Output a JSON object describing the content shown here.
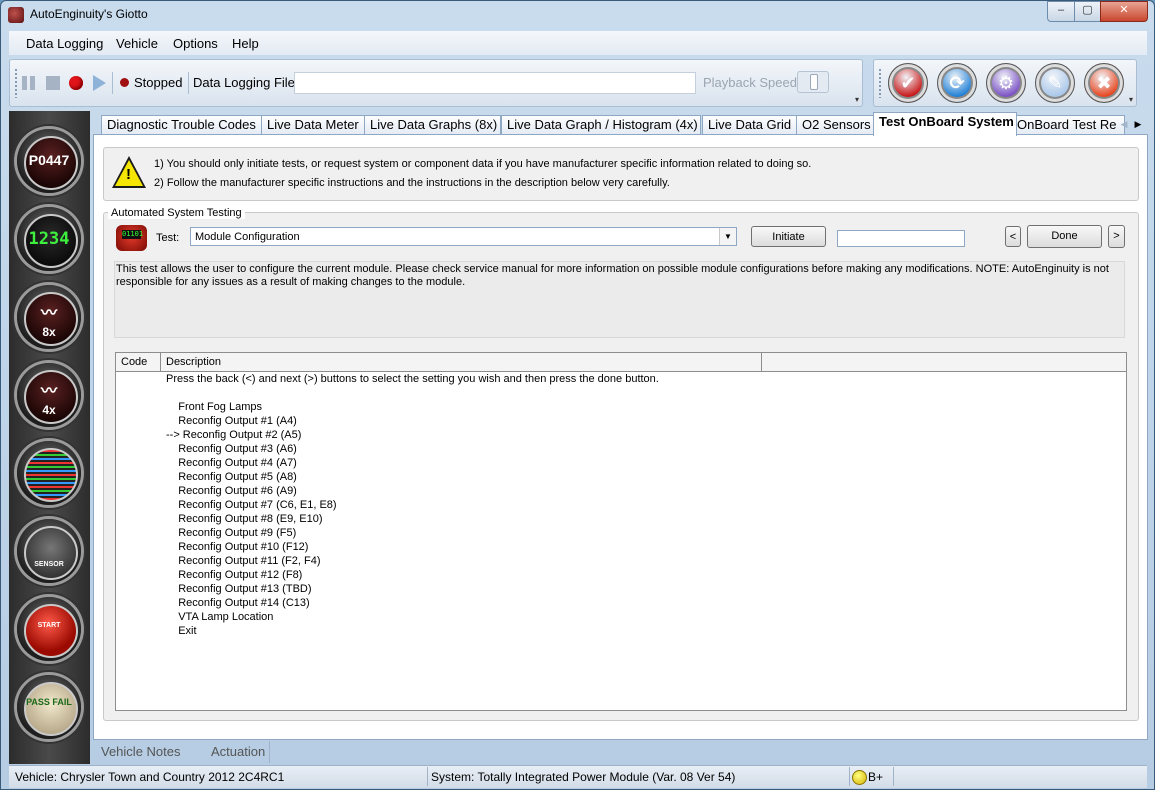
{
  "window": {
    "title": "AutoEnginuity's Giotto",
    "controls": {
      "minimize": "‒",
      "maximize": "▢",
      "close": "✕"
    }
  },
  "menu": {
    "items": [
      "Data Logging",
      "Vehicle",
      "Options",
      "Help"
    ]
  },
  "logging_toolbar": {
    "status": "Stopped",
    "file_label": "Data Logging File",
    "file_value": "",
    "playback_label": "Playback Speed"
  },
  "action_toolbar": {
    "buttons": [
      {
        "icon": "clipboard-check-icon",
        "color": "#c81414"
      },
      {
        "icon": "refresh-icon",
        "color": "#1e7fd6"
      },
      {
        "icon": "engine-rpm-icon",
        "color": "#7a4fc4"
      },
      {
        "icon": "wrench-icon",
        "color": "#a9c7ea"
      },
      {
        "icon": "no-connect-icon",
        "color": "#e8441c"
      }
    ]
  },
  "sidebar": {
    "buttons": [
      {
        "icon": "dtc-icon",
        "text": "P0447"
      },
      {
        "icon": "meter-icon",
        "text": "1234"
      },
      {
        "icon": "graph-8x-icon",
        "text": "8x"
      },
      {
        "icon": "graph-4x-icon",
        "text": "4x"
      },
      {
        "icon": "data-grid-icon",
        "text": ""
      },
      {
        "icon": "o2-sensor-icon",
        "text": "SENSOR"
      },
      {
        "icon": "start-button-icon",
        "text": "START"
      },
      {
        "icon": "pass-fail-icon",
        "text": "PASS FAIL"
      }
    ]
  },
  "tabs": {
    "items": [
      "Diagnostic Trouble Codes",
      "Live Data Meter",
      "Live Data Graphs (8x)",
      "Live Data Graph / Histogram (4x)",
      "Live Data Grid",
      "O2 Sensors",
      "Test OnBoard System",
      "OnBoard Test Re"
    ],
    "active": "Test OnBoard System"
  },
  "warning": {
    "line1": "1) You should only initiate tests, or request system or component data if you have manufacturer specific information related to doing so.",
    "line2": "2) Follow the manufacturer specific instructions and the instructions in the description below very carefully."
  },
  "automated_testing": {
    "group_title": "Automated System Testing",
    "test_label": "Test:",
    "test_icon_text": "01101",
    "test_value": "Module Configuration",
    "initiate_label": "Initiate",
    "result_value": "",
    "prev_label": "<",
    "done_label": "Done",
    "next_label": ">",
    "description": "This test allows the user to configure the current module. Please check service manual for more information on possible module configurations before making any modifications. NOTE: AutoEnginuity is not responsible for any issues as a result of making changes to the module."
  },
  "results_grid": {
    "columns": [
      "Code",
      "Description",
      ""
    ],
    "rows": [
      "Press the back (<) and next (>) buttons to select the setting you wish and then press the done button.",
      "",
      "    Front Fog Lamps",
      "    Reconfig Output #1 (A4)",
      "--> Reconfig Output #2 (A5)",
      "    Reconfig Output #3 (A6)",
      "    Reconfig Output #4 (A7)",
      "    Reconfig Output #5 (A8)",
      "    Reconfig Output #6 (A9)",
      "    Reconfig Output #7 (C6, E1, E8)",
      "    Reconfig Output #8 (E9, E10)",
      "    Reconfig Output #9 (F5)",
      "    Reconfig Output #10 (F12)",
      "    Reconfig Output #11 (F2, F4)",
      "    Reconfig Output #12 (F8)",
      "    Reconfig Output #13 (TBD)",
      "    Reconfig Output #14 (C13)",
      "    VTA Lamp Location",
      "    Exit"
    ]
  },
  "bottom_tabs": [
    "Vehicle Notes",
    "Actuation"
  ],
  "status_bar": {
    "vehicle": "Vehicle: Chrysler  Town and Country  2012  2C4RC1",
    "system": "System: Totally Integrated Power Module (Var. 08 Ver 54)",
    "battery": "B+"
  }
}
